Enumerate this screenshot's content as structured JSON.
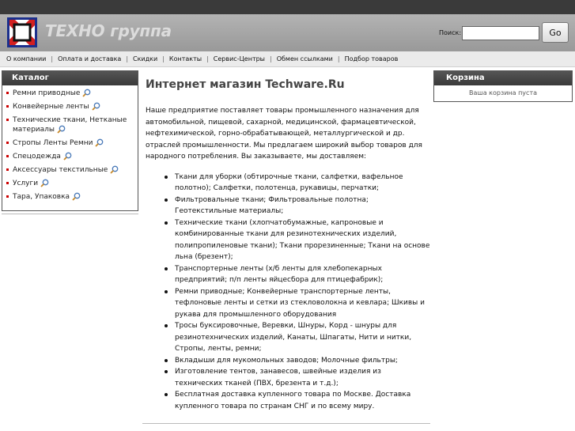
{
  "header": {
    "brand": "ТЕХНО группа",
    "search_label": "Поиск:",
    "search_value": "",
    "go_label": "Go"
  },
  "nav": [
    "О компании",
    "Оплата и доставка",
    "Скидки",
    "Контакты",
    "Сервис-Центры",
    "Обмен ссылками",
    "Подбор товаров"
  ],
  "sidebar": {
    "title": "Каталог",
    "items": [
      "Ремни приводные",
      "Конвейерные ленты",
      "Технические ткани, Нетканые материалы",
      "Стропы Ленты Ремни",
      "Спецодежда",
      "Аксессуары текстильные",
      "Услуги",
      "Тара, Упаковка"
    ]
  },
  "main": {
    "title": "Интернет магазин Techware.Ru",
    "intro": "Наше предприятие поставляет товары промышленного назначения для автомобильной, пищевой, сахарной, медицинской, фармацевтической, нефтехимической, горно-обрабатывающей, металлургической и др. отраслей промышленности. Мы предлагаем широкий выбор товаров для народного потребления. Вы заказываете, мы доставляем:",
    "bullets": [
      "Ткани для уборки (обтирочные ткани, салфетки, вафельное полотно); Салфетки, полотенца, рукавицы, перчатки;",
      "Фильтровальные ткани; Фильтровальные полотна; Геотекстильные материалы;",
      "Технические ткани (хлопчатобумажные, капроновые и комбинированные ткани для резинотехнических изделий, полипропиленовые ткани); Ткани прорезиненные; Ткани на основе льна (брезент);",
      "Транспортерные ленты (х/б ленты для хлебопекарных предприятий; п/п ленты яйцесбора для птицефабрик);",
      "Ремни приводные; Конвейерные транспортерные ленты, тефлоновые ленты и сетки из стекловолокна и кевлара; Шкивы и рукава для промышленного оборудования",
      "Тросы буксировочные, Веревки, Шнуры, Корд - шнуры для резинотехнических изделий, Канаты, Шпагаты, Нити и нитки, Стропы, ленты, ремни;",
      "Вкладыши для мукомольных заводов; Молочные фильтры;",
      "Изготовление тентов, занавесов, швейные изделия из технических тканей (ПВХ, брезента и т.д.);",
      "Бесплатная доставка купленного товара по Москве. Доставка купленного товара по странам СНГ и по всему миру."
    ]
  },
  "cart": {
    "title": "Корзина",
    "empty_text": "Ваша корзина пуста"
  },
  "colors": {
    "topstrip": "#3a3a3a",
    "header_bg": "#a6a6a6",
    "box_head": "#444444",
    "bullet_marker": "#cc0000"
  }
}
